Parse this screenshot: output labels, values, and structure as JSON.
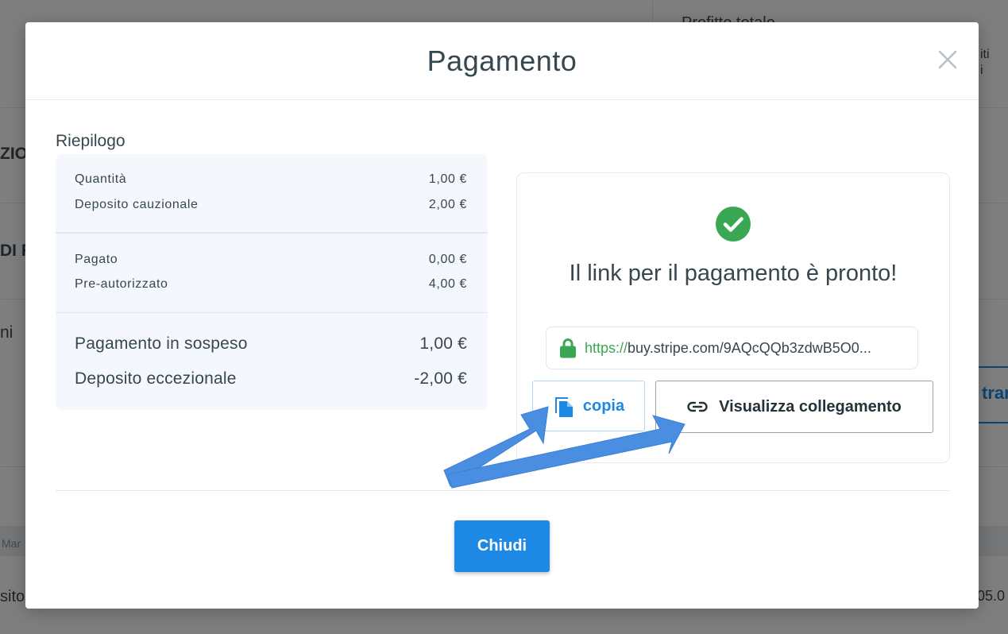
{
  "background": {
    "text_profit": "Profitto totale",
    "text_right1": "iti",
    "text_right2": "i",
    "text_zio": "ZIO",
    "text_di": "DI F",
    "text_ni": "ni",
    "text_tran": "tran",
    "text_mar": "Mar",
    "text_sito": "sito",
    "text_num": "05.0"
  },
  "modal": {
    "title": "Pagamento",
    "close_icon": "close-icon"
  },
  "summary": {
    "label": "Riepilogo",
    "rows_top": [
      {
        "label": "Quantità",
        "value": "1,00 €"
      },
      {
        "label": "Deposito cauzionale",
        "value": "2,00 €"
      }
    ],
    "rows_mid": [
      {
        "label": "Pagato",
        "value": "0,00 €"
      },
      {
        "label": "Pre-autorizzato",
        "value": "4,00 €"
      }
    ],
    "rows_bottom": [
      {
        "label": "Pagamento in sospeso",
        "value": "1,00 €"
      },
      {
        "label": "Deposito eccezionale",
        "value": "-2,00 €"
      }
    ]
  },
  "link_panel": {
    "status_icon": "check-circle-icon",
    "message": "Il link per il pagamento è pronto!",
    "url_scheme": "https://",
    "url_rest": "buy.stripe.com/9AQcQQb3zdwB5O0...",
    "copy_label": "copia",
    "view_label": "Visualizza collegamento"
  },
  "footer": {
    "close_label": "Chiudi"
  },
  "colors": {
    "accent": "#1e88e5",
    "success": "#3aa853",
    "annotation_arrow": "#4a8ee2"
  }
}
